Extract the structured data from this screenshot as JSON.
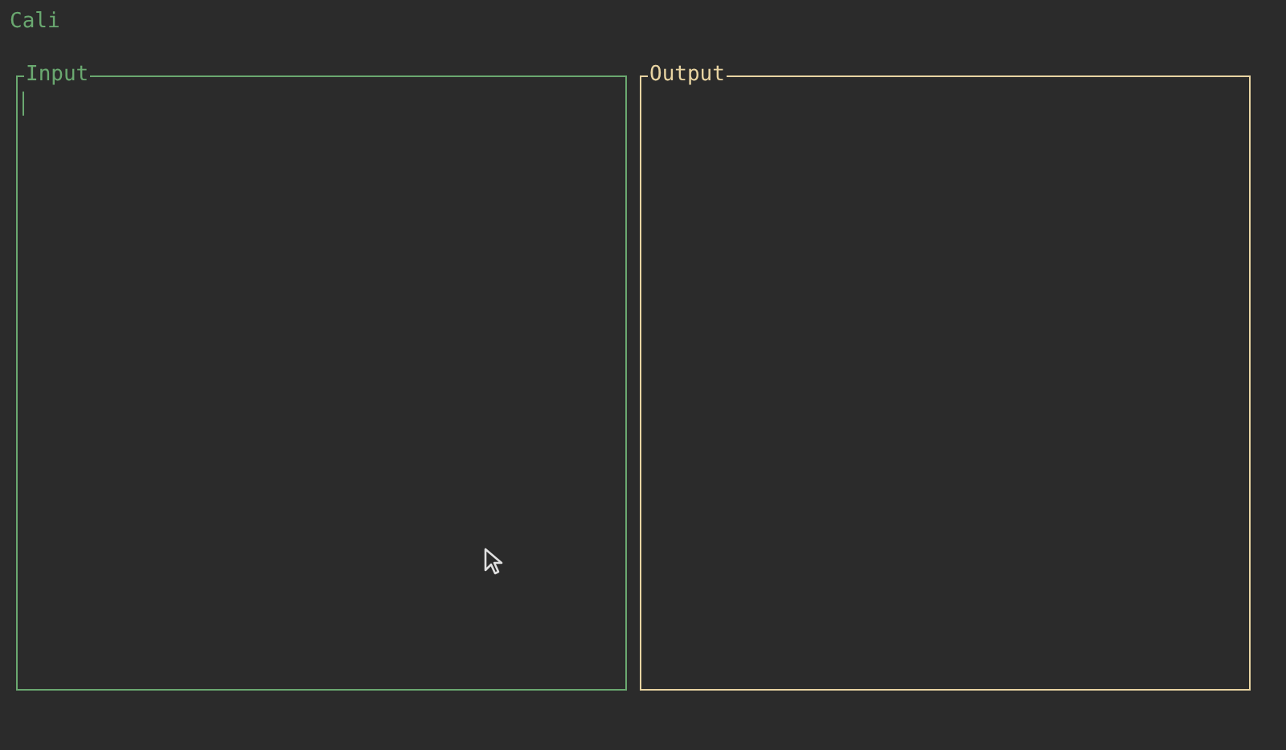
{
  "app_title": "Cali",
  "panels": [
    {
      "title": "Input",
      "color": "#6aa870",
      "focused": true
    },
    {
      "title": "Output",
      "color": "#e8d4a2",
      "focused": false
    }
  ]
}
